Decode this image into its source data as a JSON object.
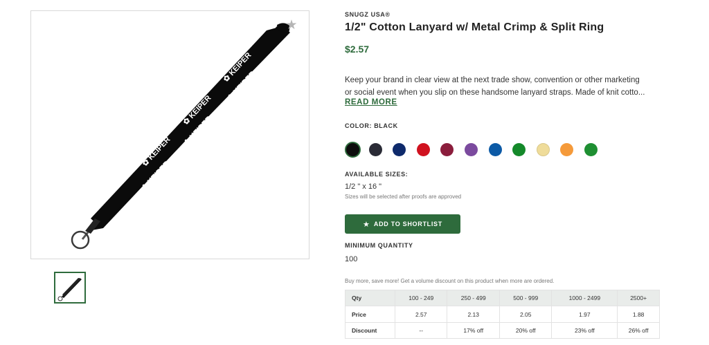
{
  "product": {
    "brand": "SNUGZ USA®",
    "title": "1/2\" Cotton Lanyard w/ Metal Crimp & Split Ring",
    "price": "$2.57",
    "description_line1": "Keep your brand in clear view at the next trade show, convention or other marketing",
    "description_line2": "or social event when you slip on these handsome lanyard straps. Made of knit cotto...",
    "read_more": "READ MORE",
    "imprint_text": "KEIPER"
  },
  "color": {
    "label": "COLOR: BLACK",
    "swatches": [
      "#0d0d0d",
      "#2a2b36",
      "#0e2a6b",
      "#d0121f",
      "#8b1d3c",
      "#7b4a9e",
      "#0c5aa6",
      "#14892a",
      "#efdc9a",
      "#f59a3a",
      "#1e8f32"
    ],
    "selected_index": 0
  },
  "sizes": {
    "label": "AVAILABLE SIZES:",
    "value": "1/2 \" x 16 \"",
    "note": "Sizes will be selected after proofs are approved"
  },
  "shortlist": {
    "label": "ADD TO SHORTLIST",
    "icon": "star-icon"
  },
  "minimum": {
    "label": "MINIMUM QUANTITY",
    "value": "100"
  },
  "pricing": {
    "note": "Buy more, save more! Get a volume discount on this product when more are ordered.",
    "headers": [
      "Qty",
      "100 - 249",
      "250 - 499",
      "500 - 999",
      "1000 - 2499",
      "2500+"
    ],
    "price_row": [
      "Price",
      "2.57",
      "2.13",
      "2.05",
      "1.97",
      "1.88"
    ],
    "discount_row": [
      "Discount",
      "--",
      "17% off",
      "20% off",
      "23% off",
      "26% off"
    ]
  },
  "colors": {
    "accent": "#2e6b3c",
    "favorite_icon": "#b5b5b5"
  }
}
